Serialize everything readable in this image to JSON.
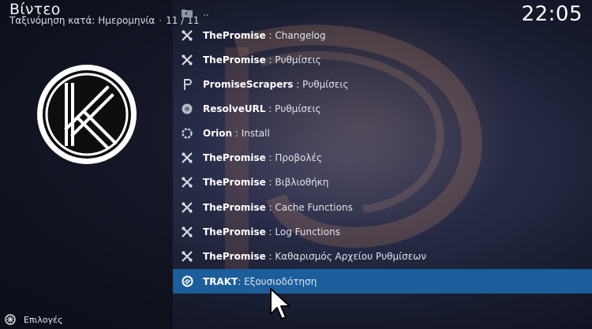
{
  "header": {
    "title": "Βίντεο",
    "sort_label": "Ταξινόμηση κατά: Ημερομηνία",
    "separator": "·",
    "position": "11 / 11"
  },
  "clock": "22:05",
  "list": {
    "parent_label": "..",
    "items": [
      {
        "addon": "ThePromise",
        "sep": " : ",
        "action": "Changelog",
        "icon": "tools-icon"
      },
      {
        "addon": "ThePromise",
        "sep": " : ",
        "action": "Ρυθμίσεις",
        "icon": "tools-icon"
      },
      {
        "addon": "PromiseScrapers",
        "sep": " : ",
        "action": "Ρυθμίσεις",
        "icon": "scrapers-icon"
      },
      {
        "addon": "ResolveURL",
        "sep": " : ",
        "action": "Ρυθμίσεις",
        "icon": "resolveurl-icon"
      },
      {
        "addon": "Orion",
        "sep": " : ",
        "action": "Install",
        "icon": "orion-icon"
      },
      {
        "addon": "ThePromise",
        "sep": " : ",
        "action": "Προβολές",
        "icon": "tools-icon"
      },
      {
        "addon": "ThePromise",
        "sep": " : ",
        "action": "Βιβλιοθήκη",
        "icon": "tools-icon"
      },
      {
        "addon": "ThePromise",
        "sep": " : ",
        "action": "Cache Functions",
        "icon": "tools-icon"
      },
      {
        "addon": "ThePromise",
        "sep": " : ",
        "action": "Log Functions",
        "icon": "tools-icon"
      },
      {
        "addon": "ThePromise",
        "sep": " : ",
        "action": "Καθαρισμός Αρχείου Ρυθμίσεων",
        "icon": "tools-icon"
      },
      {
        "addon": "TRAKT",
        "sep": ": ",
        "action": "Εξουσιοδότηση",
        "icon": "trakt-icon"
      }
    ]
  },
  "footer": {
    "options_label": "Επιλογές",
    "icon": "options-icon"
  },
  "colors": {
    "selection": "#1b5e9b",
    "background": "#1e2238"
  }
}
